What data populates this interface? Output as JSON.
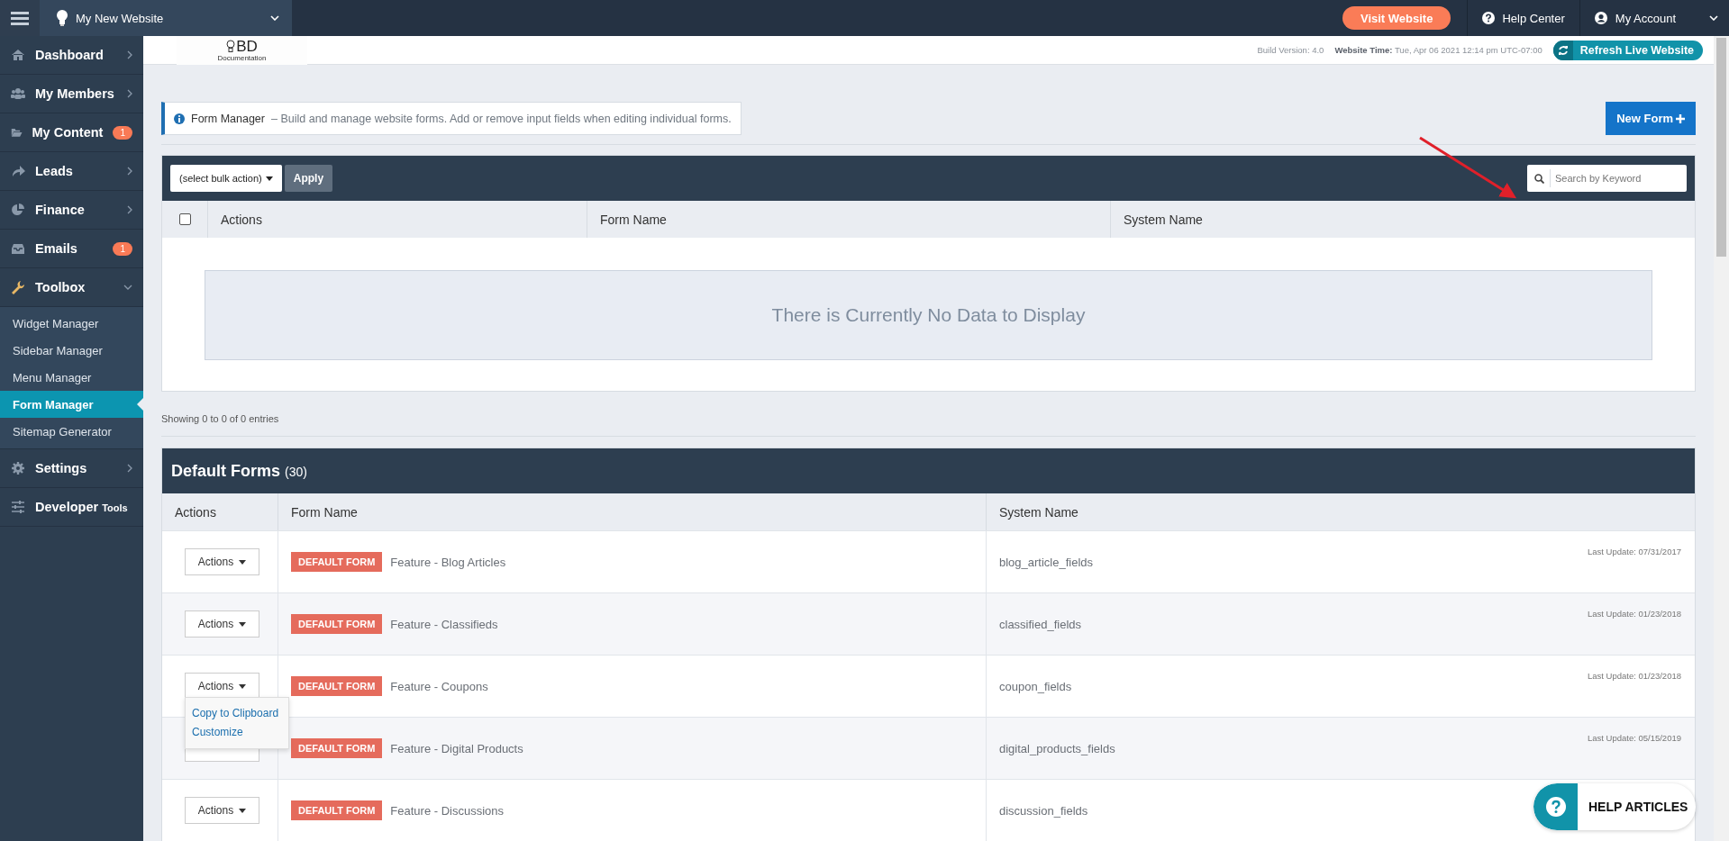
{
  "topbar": {
    "site_name": "My New Website",
    "visit_button": "Visit Website",
    "help_center": "Help Center",
    "account": "My Account"
  },
  "sidebar": {
    "items": [
      {
        "label": "Dashboard",
        "selected": false,
        "expanded": false
      },
      {
        "label": "My Members",
        "selected": false,
        "expanded": false
      },
      {
        "label": "My Content",
        "selected": false,
        "badge": "1"
      },
      {
        "label": "Leads",
        "selected": false,
        "expanded": false
      },
      {
        "label": "Finance",
        "selected": false,
        "expanded": false
      },
      {
        "label": "Emails",
        "selected": false,
        "badge": "1"
      },
      {
        "label": "Toolbox",
        "selected": false,
        "expanded": true,
        "children": [
          {
            "label": "Widget Manager",
            "selected": false
          },
          {
            "label": "Sidebar Manager",
            "selected": false
          },
          {
            "label": "Menu Manager",
            "selected": false
          },
          {
            "label": "Form Manager",
            "selected": true
          },
          {
            "label": "Sitemap Generator",
            "selected": false
          }
        ]
      },
      {
        "label": "Settings",
        "selected": false,
        "expanded": false
      },
      {
        "label": "Developer",
        "label_small": "Tools",
        "selected": false
      }
    ]
  },
  "subheader": {
    "logo_text": "BD",
    "logo_caption": "Documentation",
    "build_version": "Build Version: 4.0",
    "time_label": "Website Time:",
    "time_value": "Tue, Apr 06 2021 12:14 pm UTC-07:00",
    "refresh_button": "Refresh Live Website"
  },
  "info": {
    "title": "Form Manager",
    "text": "– Build and manage website forms. Add or remove input fields when editing individual forms."
  },
  "new_form_button": "New Form",
  "forms_table": {
    "bulk_action": "(select bulk action)",
    "apply_button": "Apply",
    "search": {
      "placeholder": "Search by Keyword"
    },
    "select_all_checked": false,
    "columns": [
      "Actions",
      "Form Name",
      "System Name"
    ],
    "empty_message": "There is Currently No Data to Display",
    "footer": "Showing 0 to 0 of 0 entries"
  },
  "default_forms": {
    "title": "Default Forms",
    "count": "(30)",
    "columns": [
      "Actions",
      "Form Name",
      "System Name"
    ],
    "rows": [
      {
        "actions": "Actions",
        "tag": "DEFAULT FORM",
        "name": "Feature - Blog Articles",
        "system_name": "blog_article_fields",
        "last_update": "Last Update: 07/31/2017"
      },
      {
        "actions": "Actions",
        "tag": "DEFAULT FORM",
        "name": "Feature - Classifieds",
        "system_name": "classified_fields",
        "last_update": "Last Update: 01/23/2018"
      },
      {
        "actions": "Actions",
        "tag": "DEFAULT FORM",
        "name": "Feature - Coupons",
        "system_name": "coupon_fields",
        "last_update": "Last Update: 01/23/2018",
        "menu": [
          "Copy to Clipboard",
          "Customize"
        ]
      },
      {
        "tag": "DEFAULT FORM",
        "name": "Feature - Digital Products",
        "system_name": "digital_products_fields",
        "last_update": "Last Update: 05/15/2019"
      },
      {
        "actions": "Actions",
        "tag": "DEFAULT FORM",
        "name": "Feature - Discussions",
        "system_name": "discussion_fields"
      }
    ]
  },
  "help_widget": {
    "label": "HELP ARTICLES"
  }
}
